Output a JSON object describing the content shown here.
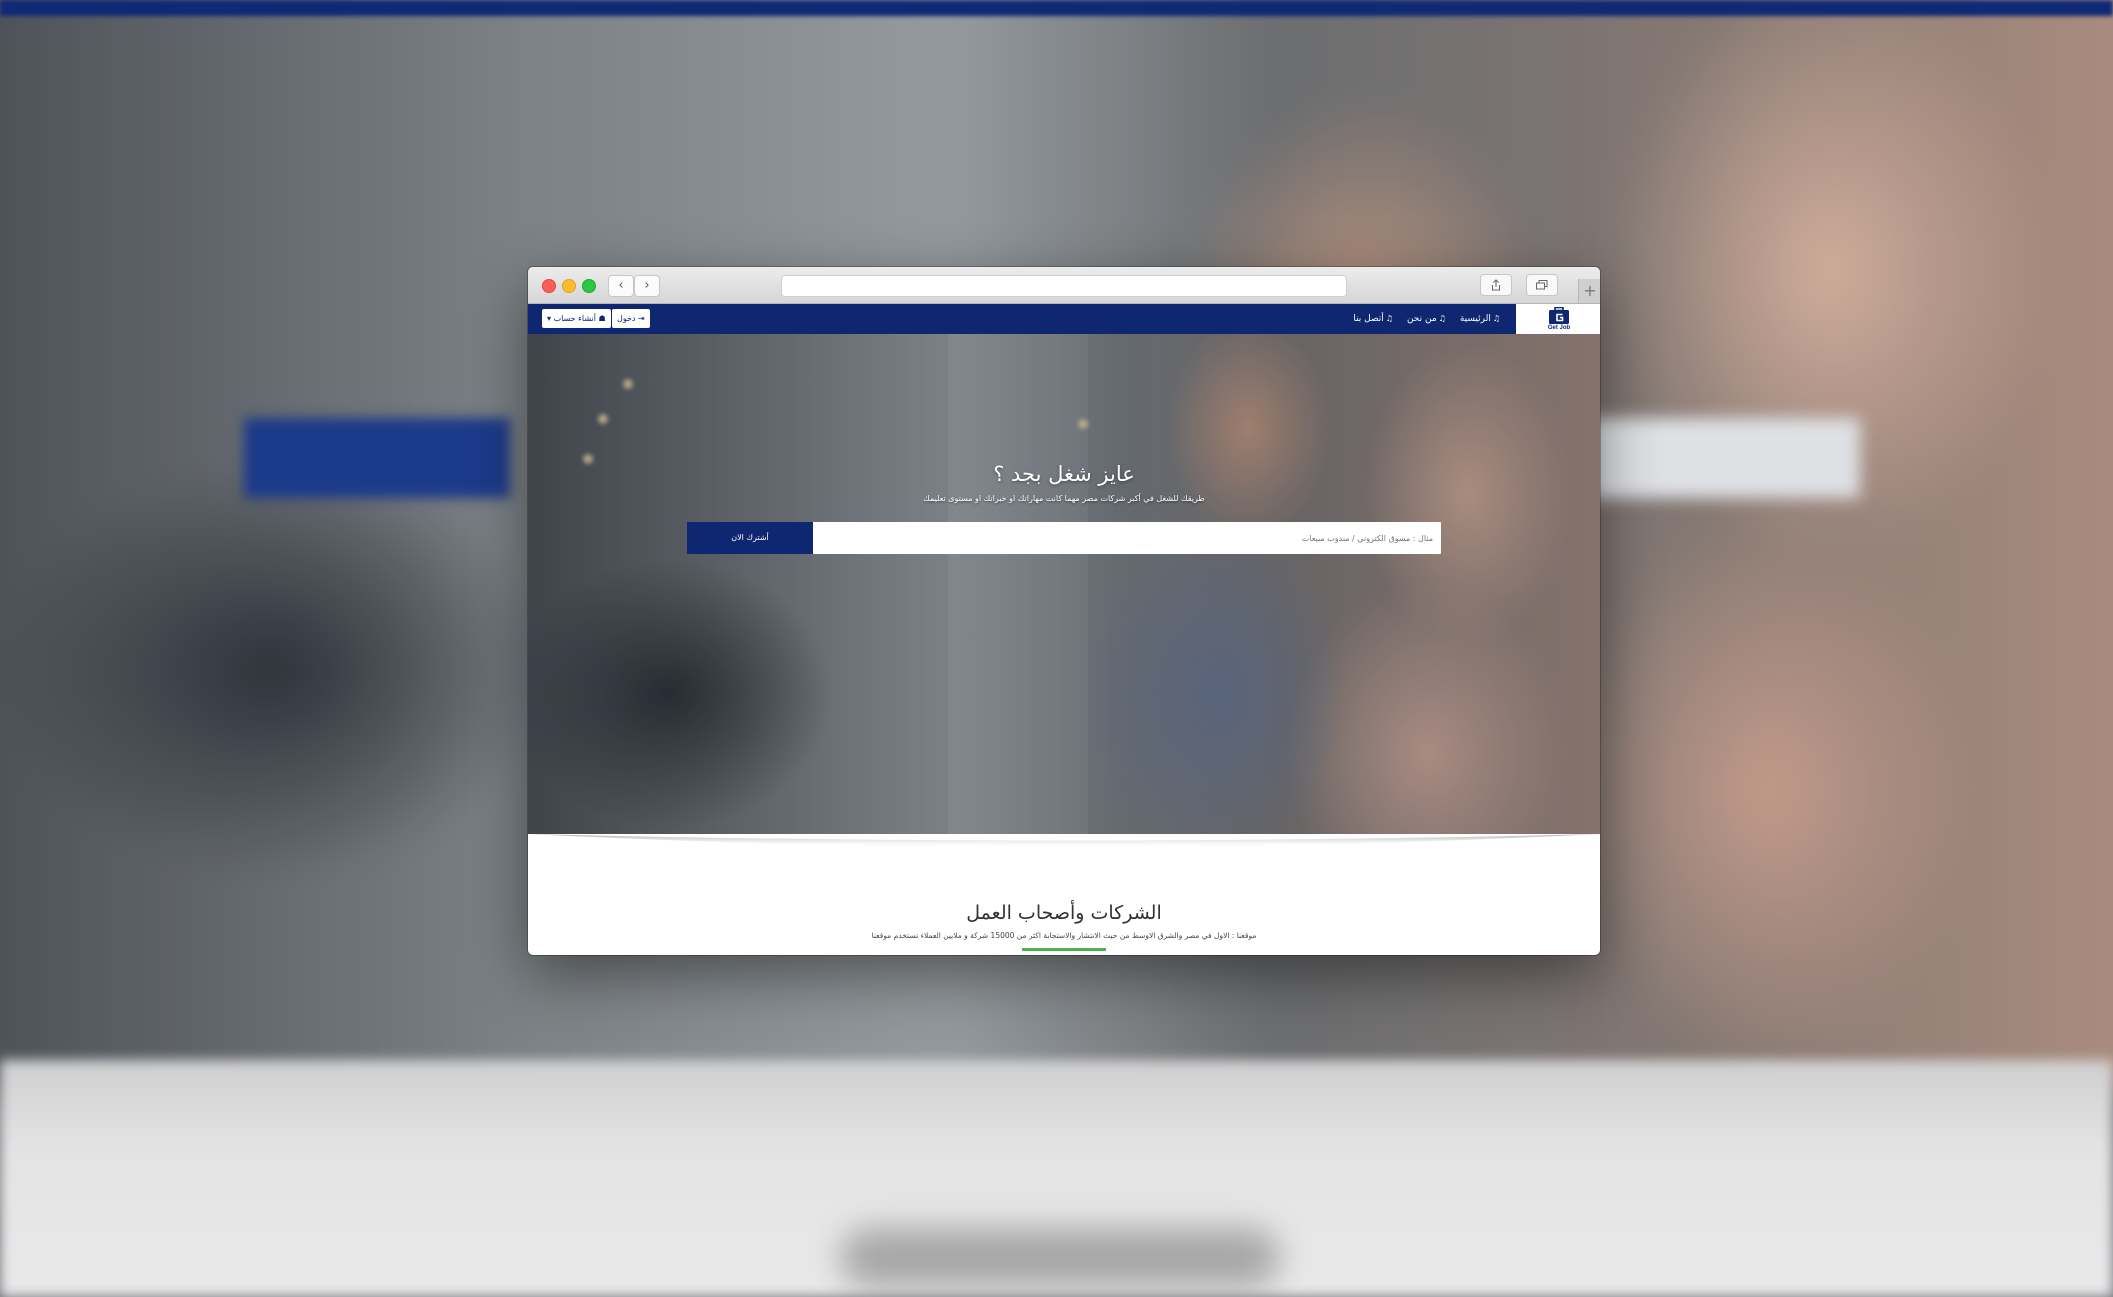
{
  "site": {
    "logo_text": "Get Job",
    "nav": {
      "home": "الرئيسية",
      "about": "من نحن",
      "contact": "أتصل بنا",
      "login": "دخول",
      "register": "أنشاء حساب"
    }
  },
  "hero": {
    "title": "عايز شغل بجد ؟",
    "subtitle": "طريقك للشغل في أكبر شركات مصر مهما كانت مهاراتك او خبراتك او مستوى تعليمك",
    "search_placeholder": "مثال : مسوق الكتروني / مندوب مبيعات",
    "search_button": "أشترك الان"
  },
  "section": {
    "title": "الشركات وأصحاب العمل",
    "subtitle": "موقعنا : الاول في مصر والشرق الاوسط من حيث الانتشار والاستجابة اكثر من 15000 شركة و ملايين العملاء تستخدم موقعنا"
  },
  "colors": {
    "nav_bg": "#0f2671",
    "accent_green": "#4caf50"
  },
  "icons": {
    "back": "chevron-left-icon",
    "forward": "chevron-right-icon",
    "share": "share-icon",
    "tabs": "tabs-icon",
    "new_tab": "plus-icon",
    "nav_link": "link-icon",
    "login": "sign-in-icon",
    "register": "user-plus-icon"
  }
}
